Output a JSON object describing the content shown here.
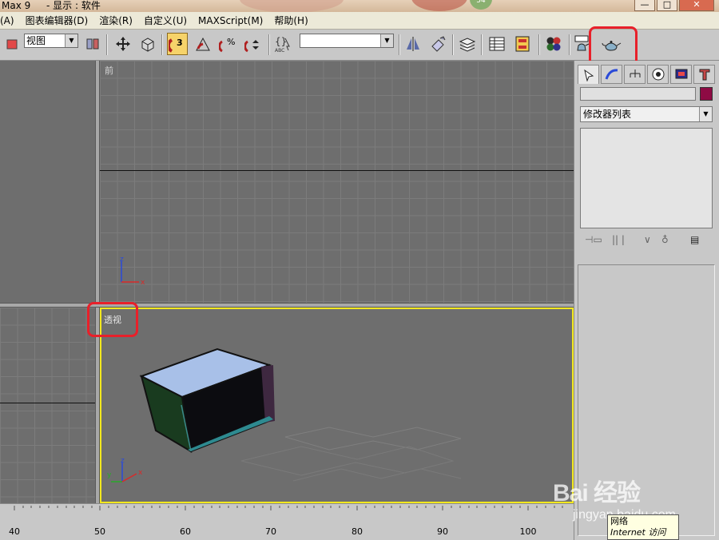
{
  "titlebar": {
    "app": "Max 9",
    "title": "- 显示 : 软件",
    "badge": "54",
    "min": "—",
    "max": "□",
    "close": "✕"
  },
  "menus": [
    "(A)",
    "图表编辑器(D)",
    "渲染(R)",
    "自定义(U)",
    "MAXScript(M)",
    "帮助(H)"
  ],
  "toolbar": {
    "view_select": "视图",
    "selection_set": "",
    "abc_label": "ABC",
    "snap_count": "3"
  },
  "viewports": {
    "front_label": "前",
    "persp_label": "透视"
  },
  "axes": {
    "x": "x",
    "y": "y",
    "z": "z"
  },
  "command_panel": {
    "modifier_list": "修改器列表",
    "object_color": "#8e0b44"
  },
  "timeline": {
    "ticks": [
      "40",
      "50",
      "60",
      "70",
      "80",
      "90",
      "100"
    ]
  },
  "tooltip": {
    "line1": "网络",
    "line2": "Internet 访问"
  },
  "watermark": {
    "logo": "Bai 经验",
    "url": "jingyan.baidu.com"
  },
  "icons": [
    "teapot-render-icon",
    "render-setup-icon",
    "material-editor-icon",
    "layer-manager-icon",
    "curve-editor-icon",
    "mirror-icon",
    "align-icon",
    "snap-3d-icon",
    "angle-snap-icon",
    "percent-snap-icon",
    "spinner-snap-icon",
    "select-move-icon",
    "select-object-icon"
  ]
}
